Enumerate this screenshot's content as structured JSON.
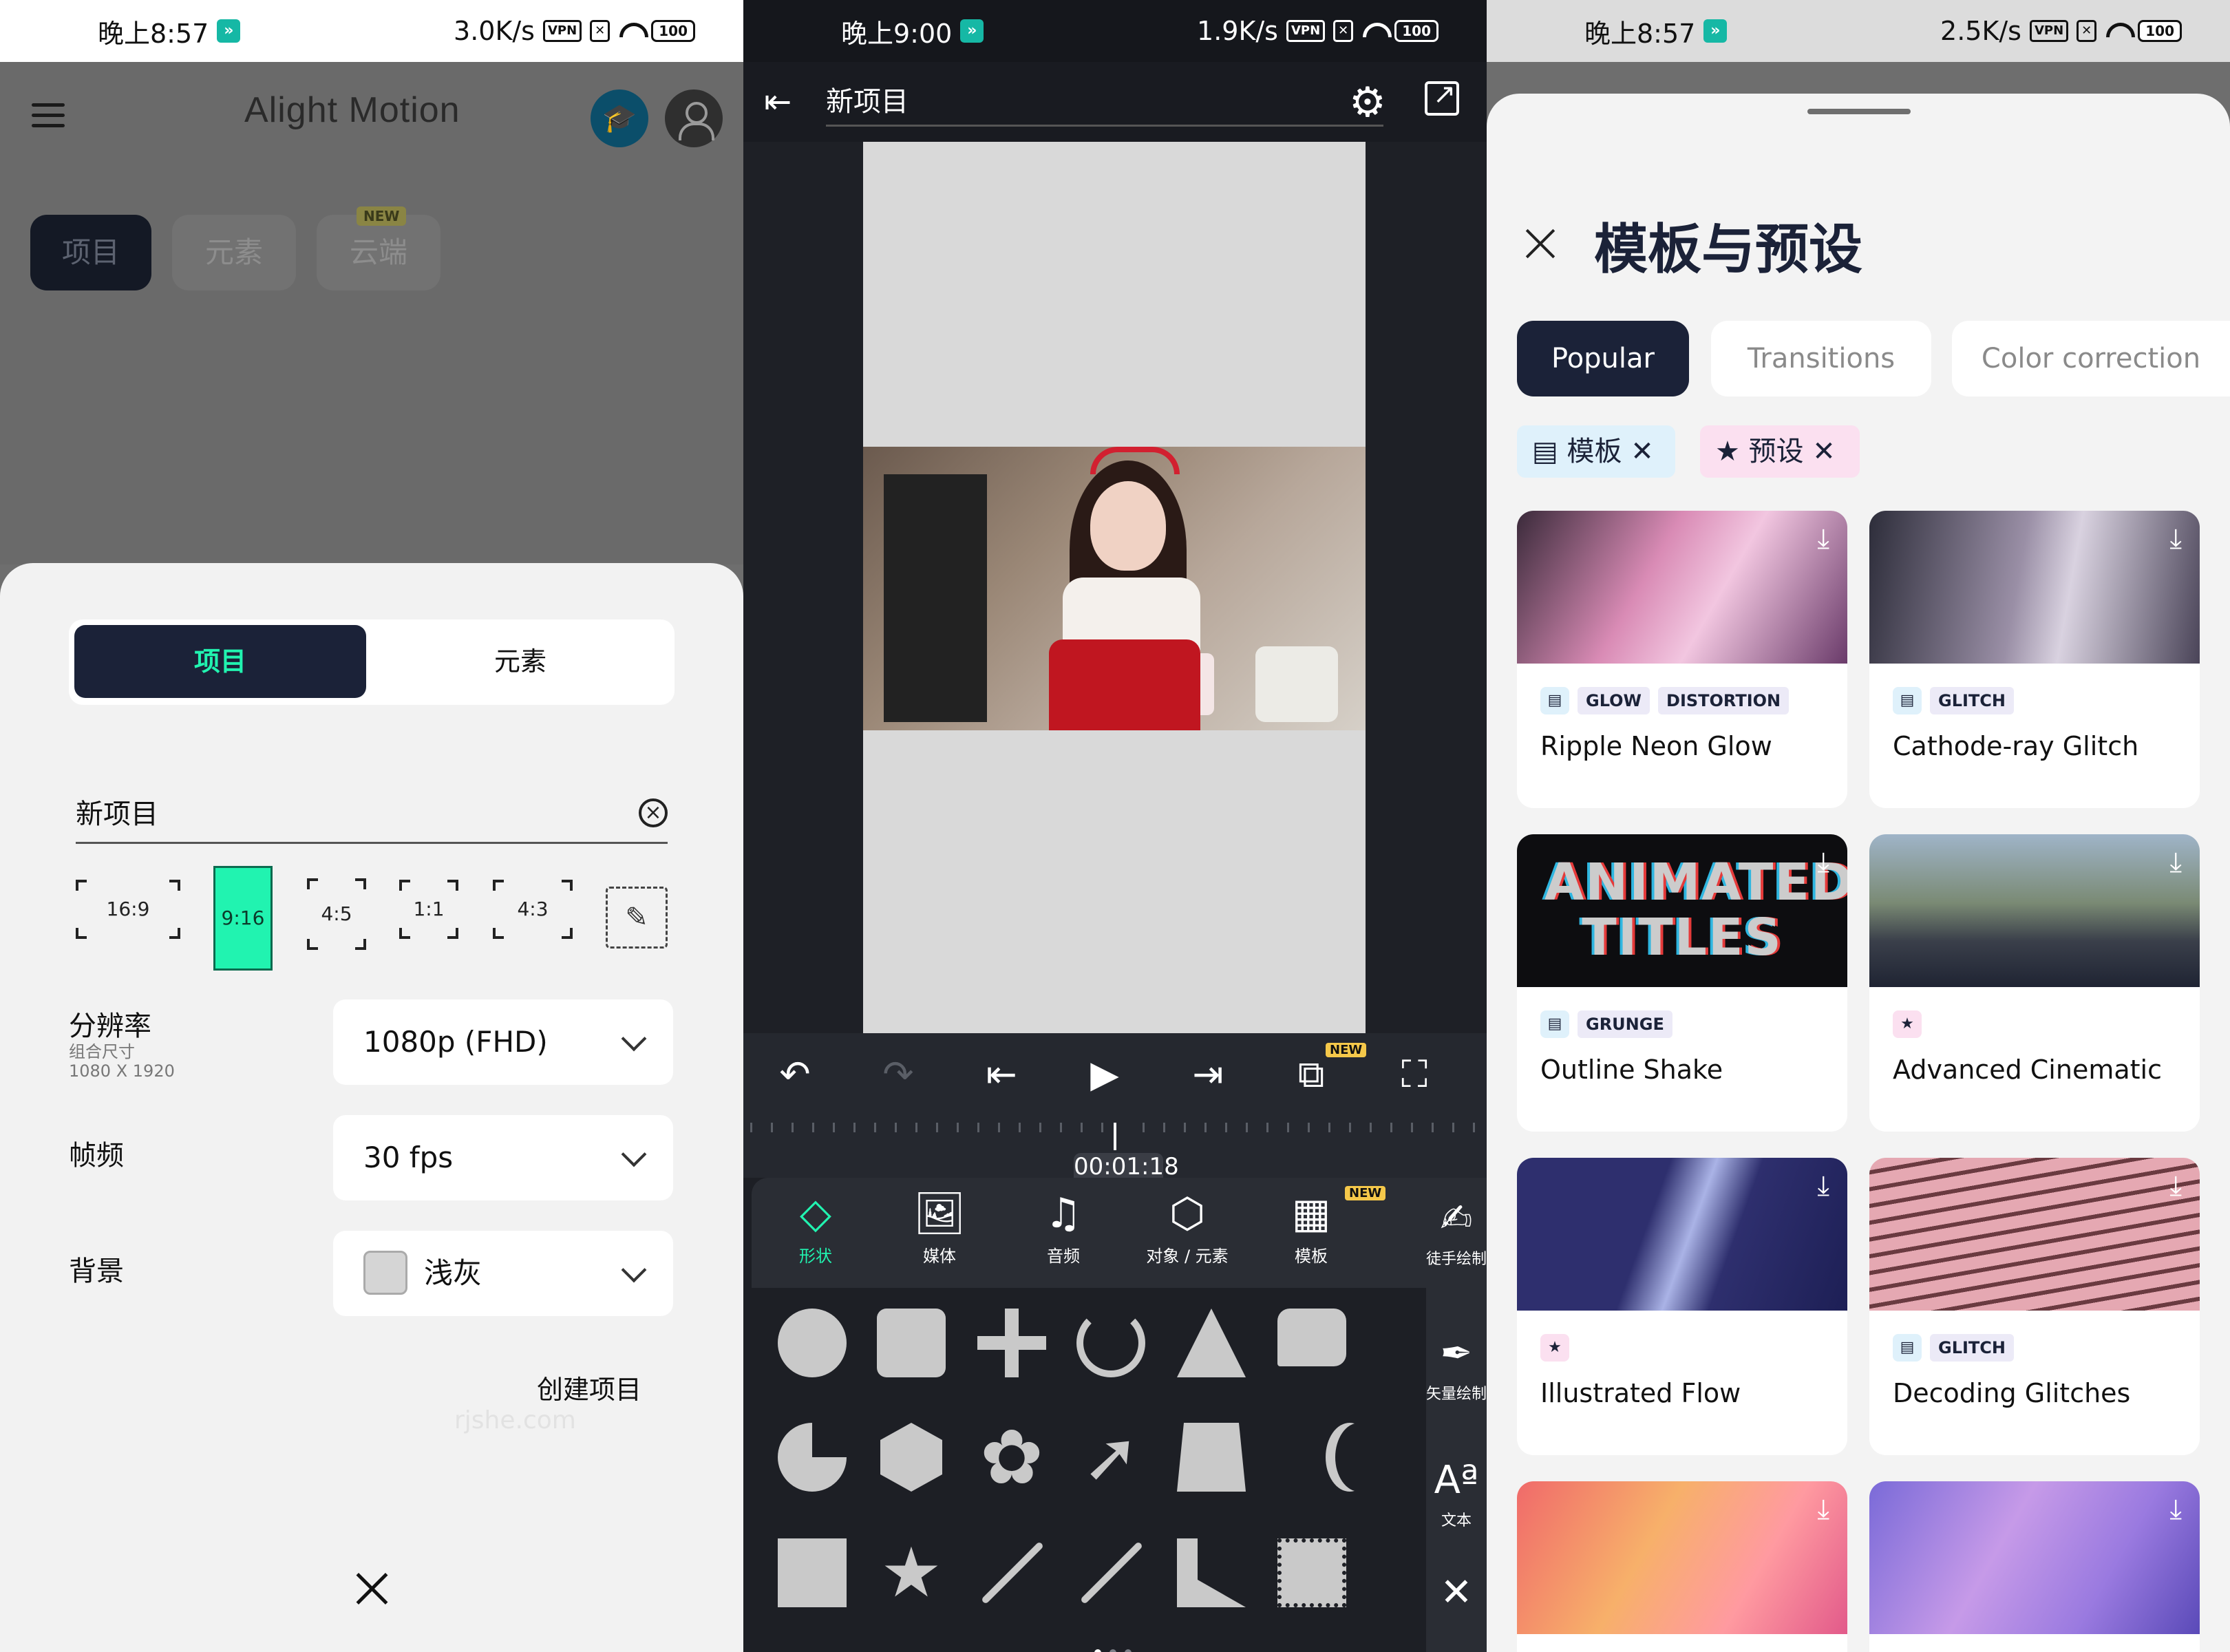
{
  "panel1": {
    "status": {
      "time": "晚上8:57",
      "speed": "3.0K/s",
      "vpn": "VPN",
      "battery": "100"
    },
    "app_title": "Alight Motion",
    "top_tabs": {
      "projects": "项目",
      "elements": "元素",
      "cloud": "云端",
      "new_badge": "NEW"
    },
    "sheet": {
      "segment": {
        "project": "项目",
        "element": "元素"
      },
      "project_name": "新项目",
      "aspect_ratios": [
        "16:9",
        "9:16",
        "4:5",
        "1:1",
        "4:3"
      ],
      "resolution_label": "分辨率",
      "resolution_sub1": "组合尺寸",
      "resolution_sub2": "1080 X 1920",
      "resolution_value": "1080p (FHD)",
      "fps_label": "帧频",
      "fps_value": "30 fps",
      "bg_label": "背景",
      "bg_value": "浅灰",
      "bg_color": "#d5d5d5",
      "create": "创建项目",
      "watermark": "rjshe.com"
    }
  },
  "panel2": {
    "status": {
      "time": "晚上9:00",
      "speed": "1.9K/s",
      "vpn": "VPN",
      "battery": "100"
    },
    "project_title": "新项目",
    "timecode": "00:01:18",
    "new_badge": "NEW",
    "tools": {
      "shape": "形状",
      "media": "媒体",
      "audio": "音频",
      "object": "对象 / 元素",
      "template": "模板"
    },
    "side_tools": {
      "freehand": "徒手绘制",
      "vector": "矢量绘制",
      "text": "文本"
    }
  },
  "panel3": {
    "status": {
      "time": "晚上8:57",
      "speed": "2.5K/s",
      "vpn": "VPN",
      "battery": "100"
    },
    "title": "模板与预设",
    "tabs": [
      "Popular",
      "Transitions",
      "Color correction"
    ],
    "filters": {
      "template": "模板",
      "preset": "预设"
    },
    "cards": [
      {
        "title": "Ripple Neon Glow",
        "tags": [
          "GLOW",
          "DISTORTION"
        ]
      },
      {
        "title": "Cathode-ray Glitch",
        "tags": [
          "GLITCH"
        ]
      },
      {
        "title": "Outline Shake",
        "tags": [
          "GRUNGE"
        ],
        "thumb_text_1": "ANIMATED",
        "thumb_text_2": "TITLES"
      },
      {
        "title": "Advanced Cinematic",
        "tags": []
      },
      {
        "title": "Illustrated Flow",
        "tags": []
      },
      {
        "title": "Decoding Glitches",
        "tags": [
          "GLITCH"
        ]
      }
    ]
  }
}
